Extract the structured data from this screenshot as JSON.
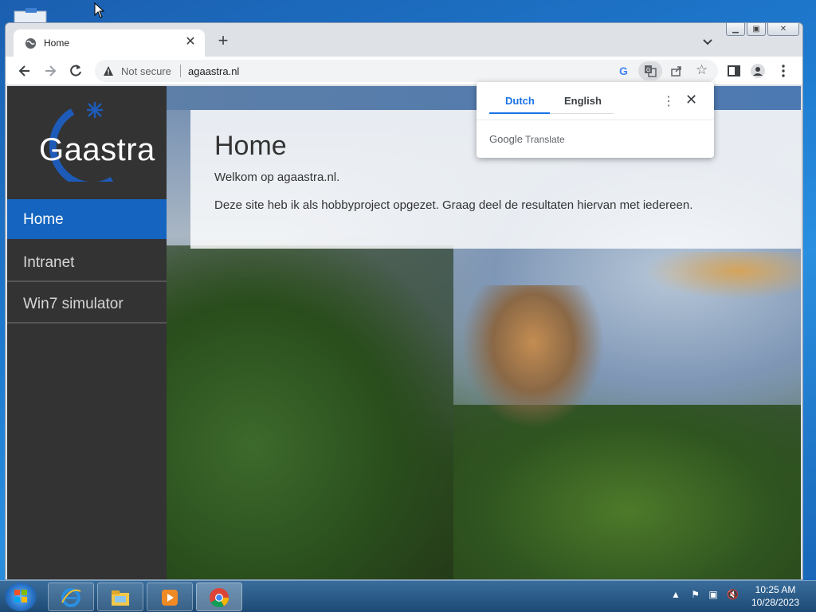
{
  "browser": {
    "tab_title": "Home",
    "security_label": "Not secure",
    "url": "agaastra.nl"
  },
  "sidebar": {
    "logo_text": "Gaastra",
    "items": [
      {
        "label": "Home"
      },
      {
        "label": "Intranet"
      },
      {
        "label": "Win7 simulator"
      }
    ]
  },
  "main": {
    "heading": "Home",
    "welcome": "Welkom op agaastra.nl.",
    "intro": "Deze site heb ik als hobbyproject opgezet. Graag deel de resultaten hiervan met iedereen."
  },
  "translate_popup": {
    "source_lang": "Dutch",
    "target_lang": "English",
    "brand_google": "Google",
    "brand_translate": "Translate"
  },
  "taskbar": {
    "time": "10:25 AM",
    "date": "10/28/2023"
  },
  "colors": {
    "accent_blue": "#1565c0",
    "sidebar_bg": "#333333",
    "chrome_link": "#1a73e8"
  }
}
